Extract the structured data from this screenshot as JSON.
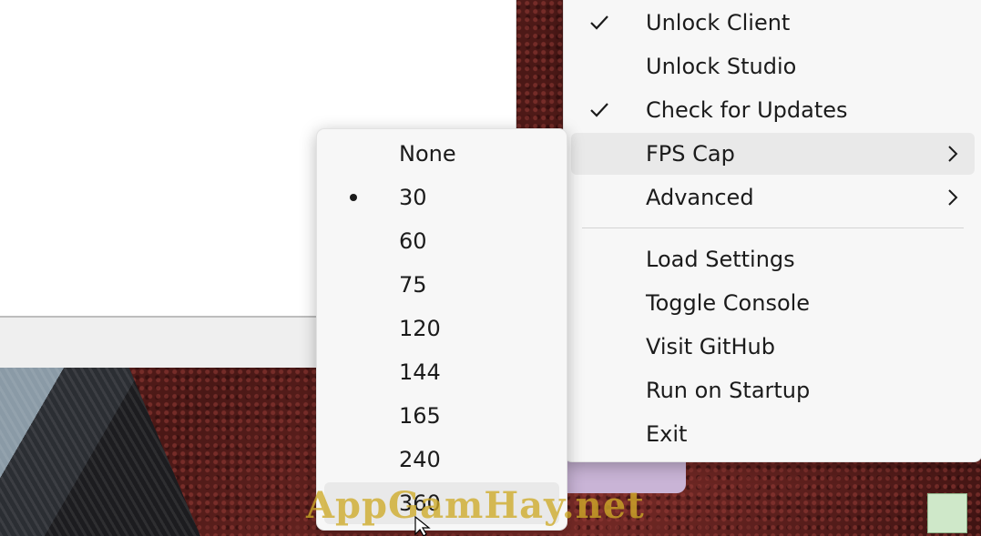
{
  "main_menu": {
    "items": [
      {
        "label": "Unlock Client",
        "checked": true
      },
      {
        "label": "Unlock Studio",
        "checked": false
      },
      {
        "label": "Check for Updates",
        "checked": true
      },
      {
        "label": "FPS Cap",
        "submenu": true,
        "highlighted": true
      },
      {
        "label": "Advanced",
        "submenu": true
      },
      {
        "label": "Load Settings"
      },
      {
        "label": "Toggle Console"
      },
      {
        "label": "Visit GitHub"
      },
      {
        "label": "Run on Startup"
      },
      {
        "label": "Exit"
      }
    ]
  },
  "fps_submenu": {
    "selected": "30",
    "hovered": "360",
    "items": [
      "None",
      "30",
      "60",
      "75",
      "120",
      "144",
      "165",
      "240",
      "360"
    ]
  },
  "watermark": "AppGamHay.net",
  "colors": {
    "highlight": "#e9e9e9",
    "menu_bg": "#f7f7f7",
    "watermark": "#ceaa28"
  }
}
